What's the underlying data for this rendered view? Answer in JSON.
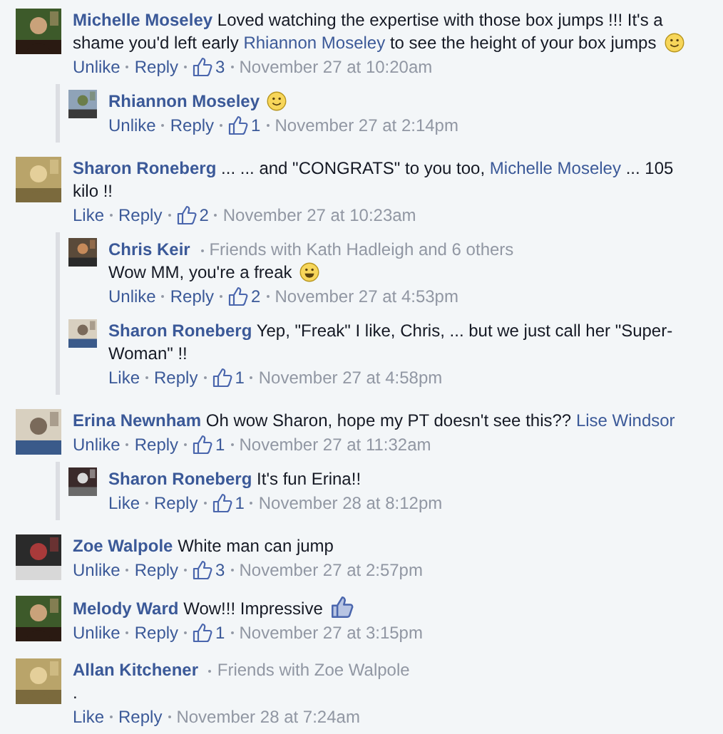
{
  "comments": [
    {
      "author": "Michelle Moseley",
      "segments": [
        {
          "kind": "plain",
          "text": "Loved watching the expertise with those box jumps !!! It's a shame you'd left early"
        },
        {
          "kind": "mention",
          "text": "Rhiannon Moseley"
        },
        {
          "kind": "plain",
          "text": "to see the height of your box jumps"
        },
        {
          "kind": "smile"
        }
      ],
      "like_label": "Unlike",
      "reply_label": "Reply",
      "likes": "3",
      "time": "November 27 at 10:20am",
      "replies": [
        {
          "author": "Rhiannon Moseley",
          "segments": [
            {
              "kind": "smile"
            }
          ],
          "like_label": "Unlike",
          "reply_label": "Reply",
          "likes": "1",
          "time": "November 27 at 2:14pm"
        }
      ]
    },
    {
      "author": "Sharon Roneberg",
      "segments": [
        {
          "kind": "plain",
          "text": "... ... and \"CONGRATS\" to you too,"
        },
        {
          "kind": "mention",
          "text": "Michelle Moseley"
        },
        {
          "kind": "plain",
          "text": "... 105 kilo !!"
        }
      ],
      "like_label": "Like",
      "reply_label": "Reply",
      "likes": "2",
      "time": "November 27 at 10:23am",
      "replies": [
        {
          "author": "Chris Keir",
          "subtitle": "Friends with Kath Hadleigh and 6 others",
          "segments": [
            {
              "kind": "plain",
              "text": "Wow MM, you're a freak"
            },
            {
              "kind": "grin"
            }
          ],
          "like_label": "Unlike",
          "reply_label": "Reply",
          "likes": "2",
          "time": "November 27 at 4:53pm"
        },
        {
          "author": "Sharon Roneberg",
          "segments": [
            {
              "kind": "plain",
              "text": "Yep, \"Freak\" I like, Chris, ... but we just call her \"Super-Woman\" !!"
            }
          ],
          "like_label": "Like",
          "reply_label": "Reply",
          "likes": "1",
          "time": "November 27 at 4:58pm"
        }
      ]
    },
    {
      "author": "Erina Newnham",
      "segments": [
        {
          "kind": "plain",
          "text": "Oh wow Sharon, hope my PT doesn't see this??"
        },
        {
          "kind": "mention",
          "text": "Lise Windsor"
        }
      ],
      "like_label": "Unlike",
      "reply_label": "Reply",
      "likes": "1",
      "time": "November 27 at 11:32am",
      "replies": [
        {
          "author": "Sharon Roneberg",
          "segments": [
            {
              "kind": "plain",
              "text": "It's fun Erina!!"
            }
          ],
          "like_label": "Like",
          "reply_label": "Reply",
          "likes": "1",
          "time": "November 28 at 8:12pm"
        }
      ]
    },
    {
      "author": "Zoe Walpole",
      "segments": [
        {
          "kind": "plain",
          "text": "White man can jump"
        }
      ],
      "like_label": "Unlike",
      "reply_label": "Reply",
      "likes": "3",
      "time": "November 27 at 2:57pm"
    },
    {
      "author": "Melody Ward",
      "segments": [
        {
          "kind": "plain",
          "text": "Wow!!! Impressive"
        },
        {
          "kind": "thumb"
        }
      ],
      "like_label": "Unlike",
      "reply_label": "Reply",
      "likes": "1",
      "time": "November 27 at 3:15pm"
    },
    {
      "author": "Allan Kitchener",
      "subtitle": "Friends with Zoe Walpole",
      "segments": [
        {
          "kind": "plain",
          "text": "."
        }
      ],
      "like_label": "Like",
      "reply_label": "Reply",
      "time": "November 28 at 7:24am"
    }
  ]
}
